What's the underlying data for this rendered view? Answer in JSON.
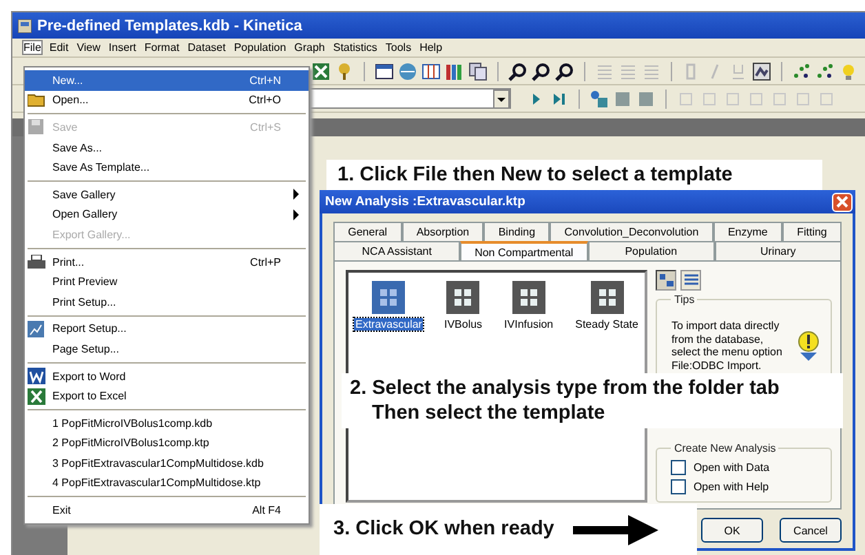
{
  "window": {
    "title": "Pre-defined Templates.kdb - Kinetica"
  },
  "menubar": [
    {
      "label": "File",
      "selected": true
    },
    {
      "label": "Edit",
      "selected": false
    },
    {
      "label": "View",
      "selected": false
    },
    {
      "label": "Insert",
      "selected": false
    },
    {
      "label": "Format",
      "selected": false
    },
    {
      "label": "Dataset",
      "selected": false
    },
    {
      "label": "Population",
      "selected": false
    },
    {
      "label": "Graph",
      "selected": false
    },
    {
      "label": "Statistics",
      "selected": false
    },
    {
      "label": "Tools",
      "selected": false
    },
    {
      "label": "Help",
      "selected": false
    }
  ],
  "file_menu": {
    "groups": [
      [
        {
          "label": "New...",
          "shortcut": "Ctrl+N",
          "selected": true,
          "disabled": false,
          "submenu": false
        },
        {
          "label": "Open...",
          "shortcut": "Ctrl+O",
          "selected": false,
          "disabled": false,
          "submenu": false
        }
      ],
      [
        {
          "label": "Save",
          "shortcut": "Ctrl+S",
          "selected": false,
          "disabled": true,
          "submenu": false
        },
        {
          "label": "Save As...",
          "selected": false,
          "disabled": false,
          "submenu": false
        },
        {
          "label": "Save As Template...",
          "selected": false,
          "disabled": false,
          "submenu": false
        }
      ],
      [
        {
          "label": "Save Gallery",
          "selected": false,
          "disabled": false,
          "submenu": true
        },
        {
          "label": "Open Gallery",
          "selected": false,
          "disabled": false,
          "submenu": true
        },
        {
          "label": "Export Gallery...",
          "selected": false,
          "disabled": true,
          "submenu": false
        }
      ],
      [
        {
          "label": "Print...",
          "shortcut": "Ctrl+P",
          "selected": false,
          "disabled": false,
          "submenu": false
        },
        {
          "label": "Print Preview",
          "selected": false,
          "disabled": false,
          "submenu": false
        },
        {
          "label": "Print Setup...",
          "selected": false,
          "disabled": false,
          "submenu": false
        }
      ],
      [
        {
          "label": "Report Setup...",
          "selected": false,
          "disabled": false,
          "submenu": false
        },
        {
          "label": "Page Setup...",
          "selected": false,
          "disabled": false,
          "submenu": false
        }
      ],
      [
        {
          "label": "Export to Word",
          "selected": false,
          "disabled": false,
          "submenu": false
        },
        {
          "label": "Export to Excel",
          "selected": false,
          "disabled": false,
          "submenu": false
        }
      ],
      [
        {
          "label": "1 PopFitMicroIVBolus1comp.kdb",
          "selected": false,
          "disabled": false,
          "submenu": false
        },
        {
          "label": "2 PopFitMicroIVBolus1comp.ktp",
          "selected": false,
          "disabled": false,
          "submenu": false
        },
        {
          "label": "3 PopFitExtravascular1CompMultidose.kdb",
          "selected": false,
          "disabled": false,
          "submenu": false
        },
        {
          "label": "4 PopFitExtravascular1CompMultidose.ktp",
          "selected": false,
          "disabled": false,
          "submenu": false
        }
      ],
      [
        {
          "label": "Exit",
          "shortcut": "Alt F4",
          "selected": false,
          "disabled": false,
          "submenu": false
        }
      ]
    ]
  },
  "dialog": {
    "title": "New Analysis :Extravascular.ktp",
    "tab_rows": [
      [
        {
          "label": "General",
          "selected": false
        },
        {
          "label": "Absorption",
          "selected": false
        },
        {
          "label": "Binding",
          "selected": false
        },
        {
          "label": "Convolution_Deconvolution",
          "selected": false
        },
        {
          "label": "Enzyme",
          "selected": false
        },
        {
          "label": "Fitting",
          "selected": false
        }
      ],
      [
        {
          "label": "NCA Assistant",
          "selected": false
        },
        {
          "label": "Non Compartmental",
          "selected": true
        },
        {
          "label": "Population",
          "selected": false
        },
        {
          "label": "Urinary",
          "selected": false
        }
      ]
    ],
    "templates": [
      {
        "label": "Extravascular",
        "selected": true
      },
      {
        "label": "IVBolus",
        "selected": false
      },
      {
        "label": "IVInfusion",
        "selected": false
      },
      {
        "label": "Steady State",
        "selected": false
      }
    ],
    "tips": {
      "title": "Tips",
      "text": "To import data directly from the database, select the menu option File:ODBC Import."
    },
    "create_new": {
      "title": "Create New Analysis",
      "options": [
        {
          "label": "Open with Data",
          "checked": false
        },
        {
          "label": "Open with Help",
          "checked": false
        }
      ]
    },
    "buttons": [
      "OK",
      "Cancel"
    ]
  },
  "callouts": [
    {
      "lines": [
        "1. Click File then New to select a template"
      ]
    },
    {
      "lines": [
        "2. Select the analysis type from the folder tab",
        "Then select the template"
      ]
    },
    {
      "lines": [
        "3. Click OK when ready"
      ]
    }
  ]
}
